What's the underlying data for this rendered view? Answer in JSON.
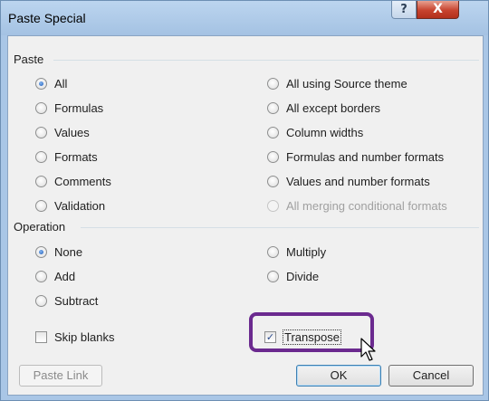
{
  "dialog": {
    "title": "Paste Special",
    "help_symbol": "?",
    "close_symbol": "X"
  },
  "paste": {
    "label": "Paste",
    "options_left": [
      {
        "label": "All",
        "checked": true,
        "disabled": false
      },
      {
        "label": "Formulas",
        "checked": false,
        "disabled": false
      },
      {
        "label": "Values",
        "checked": false,
        "disabled": false
      },
      {
        "label": "Formats",
        "checked": false,
        "disabled": false
      },
      {
        "label": "Comments",
        "checked": false,
        "disabled": false
      },
      {
        "label": "Validation",
        "checked": false,
        "disabled": false
      }
    ],
    "options_right": [
      {
        "label": "All using Source theme",
        "checked": false,
        "disabled": false
      },
      {
        "label": "All except borders",
        "checked": false,
        "disabled": false
      },
      {
        "label": "Column widths",
        "checked": false,
        "disabled": false
      },
      {
        "label": "Formulas and number formats",
        "checked": false,
        "disabled": false
      },
      {
        "label": "Values and number formats",
        "checked": false,
        "disabled": false
      },
      {
        "label": "All merging conditional formats",
        "checked": false,
        "disabled": true
      }
    ]
  },
  "operation": {
    "label": "Operation",
    "options_left": [
      {
        "label": "None",
        "checked": true
      },
      {
        "label": "Add",
        "checked": false
      },
      {
        "label": "Subtract",
        "checked": false
      }
    ],
    "options_right": [
      {
        "label": "Multiply",
        "checked": false
      },
      {
        "label": "Divide",
        "checked": false
      }
    ]
  },
  "checkboxes": {
    "skip_blanks": {
      "label": "Skip blanks",
      "checked": false
    },
    "transpose": {
      "label": "Transpose",
      "checked": true
    }
  },
  "buttons": {
    "paste_link": "Paste Link",
    "ok": "OK",
    "cancel": "Cancel"
  },
  "colors": {
    "highlight_border": "#6b2a8f",
    "title_bar": "#a9c6e6",
    "close_button": "#c7432e"
  }
}
